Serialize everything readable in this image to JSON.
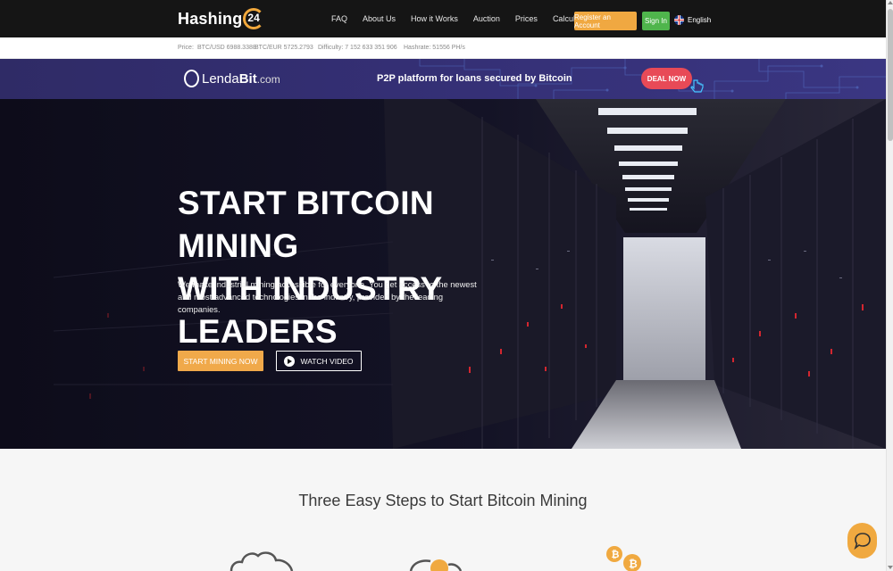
{
  "header": {
    "logo_text": "Hashing",
    "logo_number": "24",
    "nav": [
      "FAQ",
      "About Us",
      "How it Works",
      "Auction",
      "Prices",
      "Calculator"
    ],
    "register_label": "Register an Account",
    "signin_label": "Sign In",
    "language": "English",
    "colors": {
      "register": "#f0a841",
      "signin": "#4fb54c"
    }
  },
  "ticker": {
    "price_label": "Price:",
    "btc_usd": "BTC/USD 6988.3388",
    "btc_eur": "BTC/EUR 5725.2793",
    "difficulty": "Difficulty: 7 152 633 351 906",
    "hashrate": "Hashrate: 51556 PH/s"
  },
  "banner": {
    "brand_main": "Lenda",
    "brand_bold": "Bit",
    "brand_domain": ".com",
    "tagline": "P2P platform for loans secured by Bitcoin",
    "deal_label": "DEAL NOW"
  },
  "hero": {
    "title_line1": "START BITCOIN MINING",
    "title_line2": "WITH INDUSTRY LEADERS",
    "description": "We make industrial mining accessible for everyone. You get access to the newest and most advanced technologies in the industry, provided by the leading companies.",
    "start_label": "START MINING NOW",
    "video_label": "WATCH VIDEO"
  },
  "steps": {
    "title": "Three Easy Steps to Start Bitcoin Mining",
    "icons": [
      "cloud-icon",
      "bitcoin-coin-icon",
      "bitcoin-coins-icon"
    ]
  },
  "chat": {
    "icon": "chat-bubble-icon"
  }
}
